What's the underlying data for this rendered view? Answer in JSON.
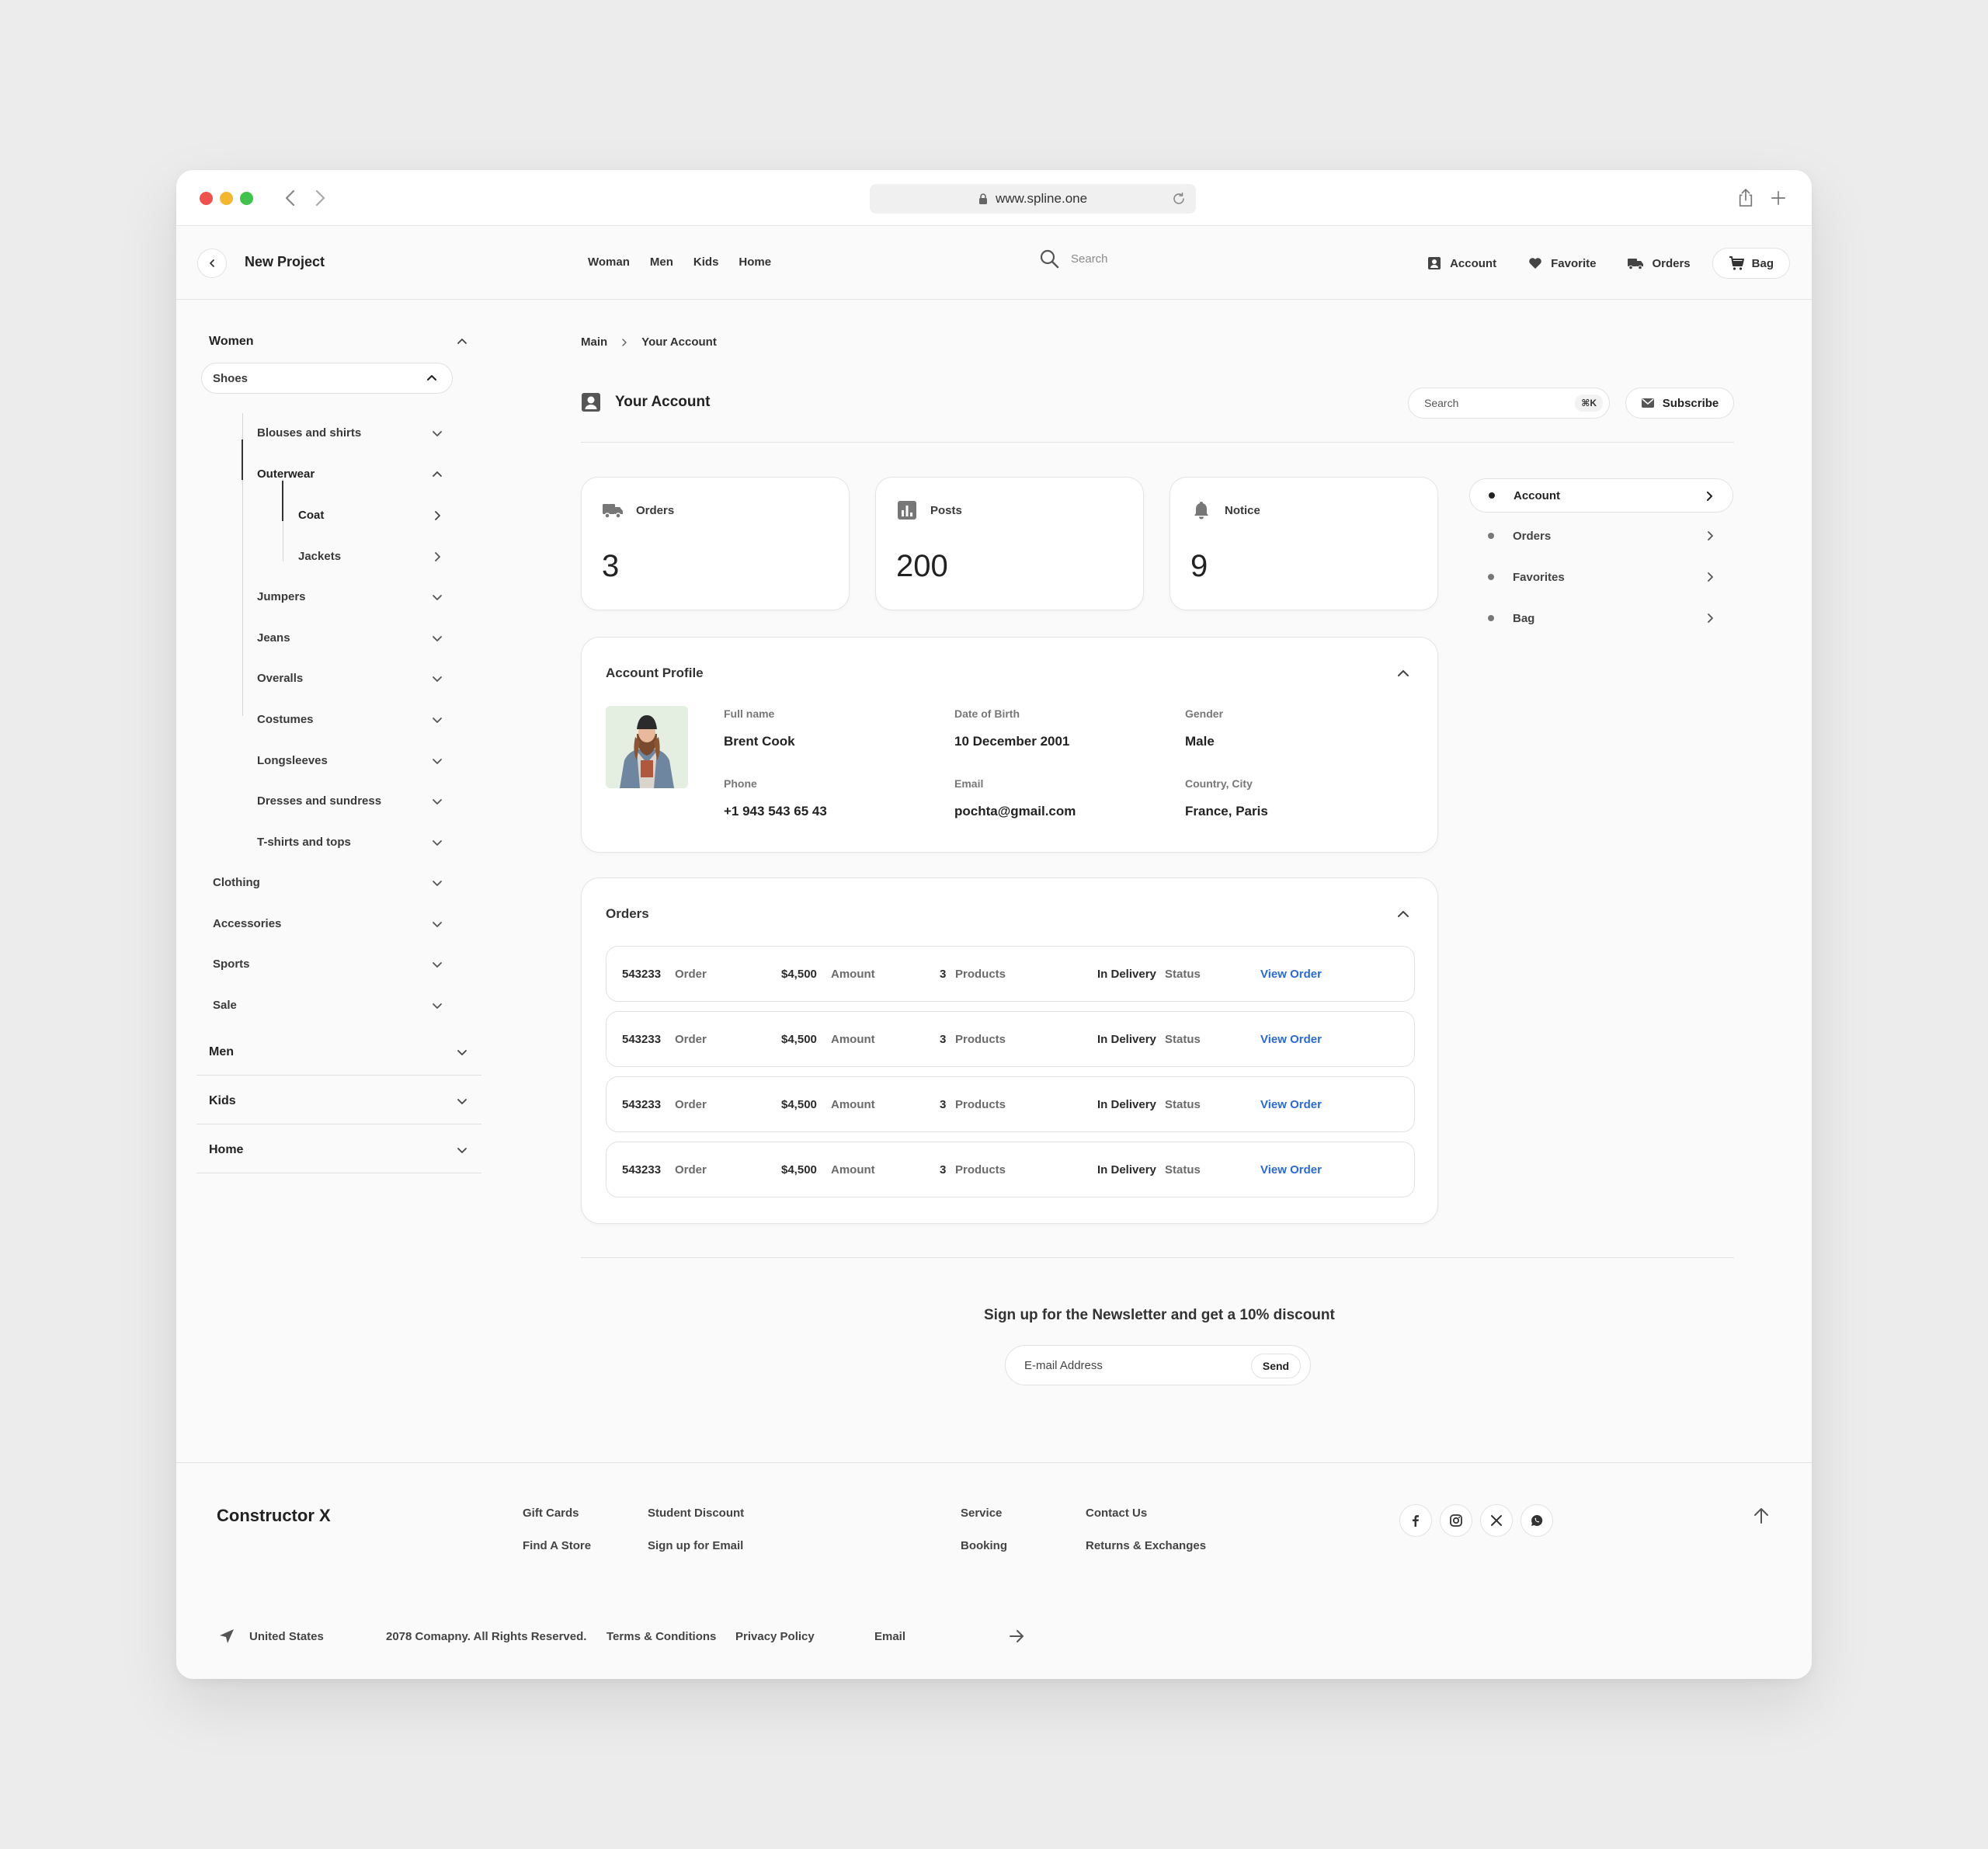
{
  "browser": {
    "url": "www.spline.one"
  },
  "header": {
    "project_title": "New Project",
    "nav": [
      "Woman",
      "Men",
      "Kids",
      "Home"
    ],
    "search_placeholder": "Search",
    "actions": {
      "account": "Account",
      "favorite": "Favorite",
      "orders": "Orders",
      "bag": "Bag"
    }
  },
  "sidebar": {
    "women": "Women",
    "shoes": "Shoes",
    "blouses": "Blouses and shirts",
    "outerwear": "Outerwear",
    "coat": "Coat",
    "jackets": "Jackets",
    "jumpers": "Jumpers",
    "jeans": "Jeans",
    "overalls": "Overalls",
    "costumes": "Costumes",
    "longsleeves": "Longsleeves",
    "dresses": "Dresses and sundress",
    "tshirts": "T-shirts and tops",
    "clothing": "Clothing",
    "accessories": "Accessories",
    "sports": "Sports",
    "sale": "Sale",
    "men": "Men",
    "kids": "Kids",
    "home": "Home"
  },
  "breadcrumb": {
    "main": "Main",
    "current": "Your Account"
  },
  "page": {
    "title": "Your Account",
    "search_placeholder": "Search",
    "search_shortcut": "⌘K",
    "subscribe": "Subscribe"
  },
  "stats": {
    "orders": {
      "label": "Orders",
      "value": "3"
    },
    "posts": {
      "label": "Posts",
      "value": "200"
    },
    "notice": {
      "label": "Notice",
      "value": "9"
    }
  },
  "side_menu": {
    "account": "Account",
    "orders": "Orders",
    "favorites": "Favorites",
    "bag": "Bag"
  },
  "profile": {
    "title": "Account Profile",
    "full_name_label": "Full name",
    "full_name": "Brent Cook",
    "dob_label": "Date of Birth",
    "dob": "10 December 2001",
    "gender_label": "Gender",
    "gender": "Male",
    "phone_label": "Phone",
    "phone": "+1 943 543 65 43",
    "email_label": "Email",
    "email": "pochta@gmail.com",
    "location_label": "Country, City",
    "location": "France, Paris"
  },
  "orders": {
    "title": "Orders",
    "labels": {
      "order": "Order",
      "amount": "Amount",
      "products": "Products",
      "status": "Status",
      "link": "View Order"
    },
    "rows": [
      {
        "id": "543233",
        "amount": "$4,500",
        "products": "3",
        "status": "In Delivery"
      },
      {
        "id": "543233",
        "amount": "$4,500",
        "products": "3",
        "status": "In Delivery"
      },
      {
        "id": "543233",
        "amount": "$4,500",
        "products": "3",
        "status": "In Delivery"
      },
      {
        "id": "543233",
        "amount": "$4,500",
        "products": "3",
        "status": "In Delivery"
      }
    ]
  },
  "newsletter": {
    "title": "Sign up for the Newsletter and get a 10% discount",
    "placeholder": "E-mail Address",
    "send": "Send"
  },
  "footer": {
    "brand": "Constructor X",
    "links": {
      "gift_cards": "Gift Cards",
      "student_discount": "Student Discount",
      "find_store": "Find A Store",
      "signup_email": "Sign up for Email",
      "service": "Service",
      "contact_us": "Contact Us",
      "booking": "Booking",
      "returns": "Returns & Exchanges"
    },
    "location": "United States",
    "copyright": "2078 Comapny. All Rights Reserved.",
    "terms": "Terms & Conditions",
    "privacy": "Privacy Policy",
    "email_label": "Email",
    "social": [
      "facebook",
      "instagram",
      "x",
      "whatsapp"
    ]
  },
  "colors": {
    "accent_link": "#2a6ad6",
    "traffic_red": "#f0514c",
    "traffic_yellow": "#f4b62d",
    "traffic_green": "#3fc34a"
  }
}
